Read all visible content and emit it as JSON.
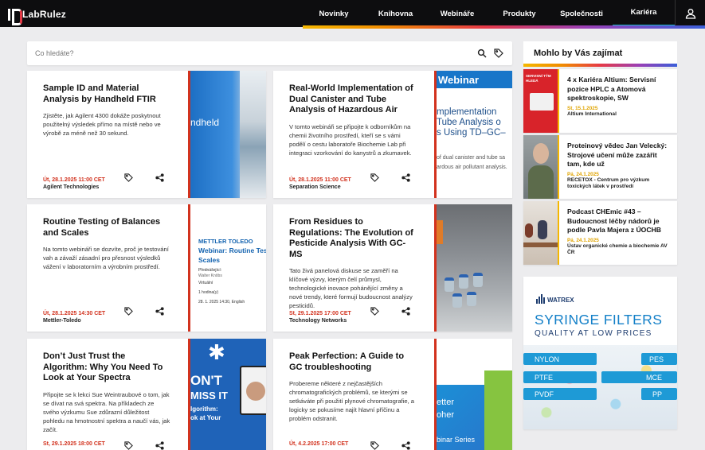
{
  "header": {
    "logo_text": "LabRulez",
    "nav": [
      {
        "label": "Novinky"
      },
      {
        "label": "Knihovna"
      },
      {
        "label": "Webináře"
      },
      {
        "label": "Produkty"
      },
      {
        "label": "Společnosti"
      },
      {
        "label": "Kariéra",
        "active": true
      }
    ],
    "user_icon": "user-icon",
    "accent_color": "#19b5c8"
  },
  "search": {
    "placeholder": "Co hledáte?",
    "value": "",
    "icons": [
      "search-icon",
      "tag-icon"
    ]
  },
  "cards": [
    {
      "title": "Sample ID and Material Analysis by Handheld FTIR",
      "desc": "Zjistěte, jak Agilent 4300 dokáže poskytnout použitelný výsledek přímo na místě nebo ve výrobě za méně než 30 sekund.",
      "date": "Út, 28.1.2025 11:00 CET",
      "org": "Agilent Technologies",
      "thumb_text": "ndheld"
    },
    {
      "title": "Real-World Implementation of Dual Canister and Tube Analysis of Hazardous Air",
      "desc": "V tomto webináři se připojte k odborníkům na chemii životního prostředí, kteří se s vámi podělí o cestu laboratoře Biochemie Lab při integraci vzorkování do kanystrů a zkumavek.",
      "date": "Út, 28.1.2025 11:00 CET",
      "org": "Separation Science",
      "thumb_label": "Webinar",
      "thumb_lines": [
        "mplementation",
        "Tube Analysis o",
        "s Using TD–GC–",
        "of dual canister and tube sa",
        "ardous air pollutant analysis."
      ]
    },
    {
      "title": "Routine Testing of Balances and Scales",
      "desc": "Na tomto webináři se dozvíte, proč je testování vah a závaží zásadní pro přesnost výsledků vážení v laboratorním a výrobním prostředí.",
      "date": "Út, 28.1.2025 14:30 CET",
      "org": "Mettler-Toledo",
      "thumb_lines": [
        "METTLER TOLEDO",
        "Webinar: Routine Test",
        "Scales",
        "Přednášející:",
        "Walter Knöbs",
        "Virtuální",
        "1 hodina(y)",
        "28. 1. 2025 14:30, English"
      ]
    },
    {
      "title": "From Residues to Regulations: The Evolution of Pesticide Analysis With GC-MS",
      "desc": "Tato živá panelová diskuse se zaměří na klíčové výzvy, kterým čelí průmysl, technologické inovace pohánějící změny a nové trendy, které formují budoucnost analýzy pesticidů.",
      "date": "St, 29.1.2025 17:00 CET",
      "org": "Technology Networks"
    },
    {
      "title": "Don’t Just Trust the Algorithm: Why You Need To Look at Your Spectra",
      "desc": "Připojte se k lekci Sue Weintraubové o tom, jak se dívat na svá spektra. Na příkladech ze svého výzkumu Sue zdůrazní důležitost pohledu na hmotnostní spektra a naučí vás, jak začít.",
      "date": "St, 29.1.2025 18:00 CET",
      "org": "",
      "thumb_lines": [
        "ON'T",
        "MISS IT",
        "lgorithm:",
        "ok at Your"
      ]
    },
    {
      "title": "Peak Perfection: A Guide to GC troubleshooting",
      "desc": "Probereme některé z nejčastějších chromatografických problémů, se kterými se setkáváte při použití plynové chromatografie, a logicky se pokusíme najít hlavní příčinu a problém odstranit.",
      "date": "Út, 4.2.2025 17:00 CET",
      "org": "",
      "thumb_lines": [
        "etter",
        "oher",
        "binar Series"
      ]
    }
  ],
  "sidebar": {
    "title": "Mohlo by Vás zajímat",
    "items": [
      {
        "title": "4 x Kariéra Altium: Servisní pozice HPLC a Atomová spektroskopie, SW",
        "date": "St, 15.1.2025",
        "org": "Altium International",
        "img_text": [
          "SERVISNÍ TÝM",
          "HLEDÁ"
        ]
      },
      {
        "title": "Proteinový vědec Jan Velecký: Strojové učení může zazářit tam, kde už",
        "date": "Pá, 24.1.2025",
        "org": "RECETOX - Centrum pro výzkum toxických látek v prostředí"
      },
      {
        "title": "Podcast CHEmic #43 – Budoucnost léčby nádorů je podle Pavla Majera z ÚOCHB",
        "date": "Pá, 24.1.2025",
        "org": "Ústav organické chemie a biochemie AV ČR"
      }
    ]
  },
  "ad": {
    "brand": "WATREX",
    "headline": "SYRINGE FILTERS",
    "sub": "QUALITY AT LOW PRICES",
    "labels": [
      "NYLON",
      "PES",
      "PTFE",
      "MCE",
      "PVDF",
      "PP"
    ]
  }
}
